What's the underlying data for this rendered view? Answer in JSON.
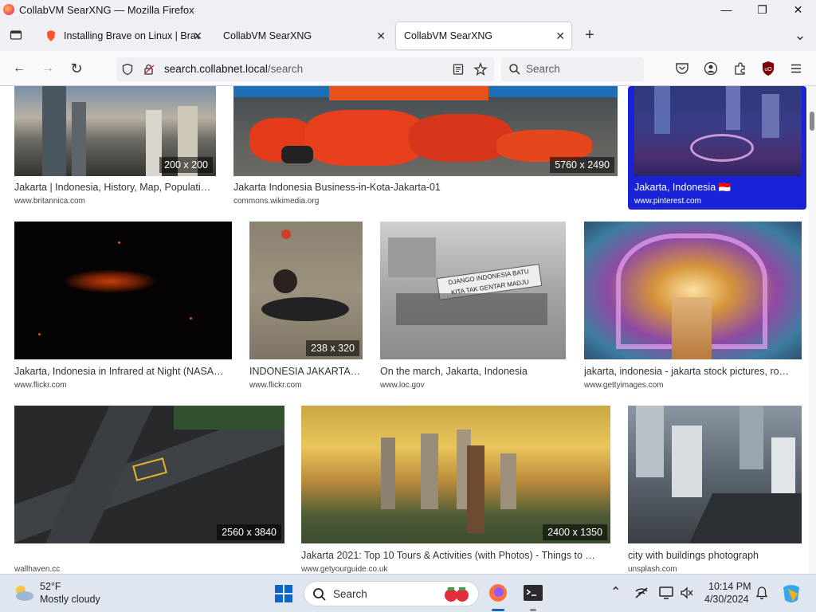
{
  "window": {
    "title": "CollabVM SearXNG — Mozilla Firefox",
    "minimize": "—",
    "maximize": "❐",
    "close": "✕"
  },
  "tabs": [
    {
      "label": "Installing Brave on Linux | Brave",
      "close": "✕"
    },
    {
      "label": "CollabVM SearXNG",
      "close": "✕"
    },
    {
      "label": "CollabVM SearXNG",
      "close": "✕"
    }
  ],
  "new_tab": "+",
  "tab_list": "⌄",
  "nav": {
    "back": "←",
    "forward": "→",
    "reload": "↻",
    "url_host": "search.collabnet.local",
    "url_path": "/search",
    "search_placeholder": "Search"
  },
  "results": [
    {
      "title": "Jakarta | Indonesia, History, Map, Populati…",
      "source": "www.britannica.com",
      "dims": "200 x 200"
    },
    {
      "title": "Jakarta Indonesia Business-in-Kota-Jakarta-01",
      "source": "commons.wikimedia.org",
      "dims": "5760 x 2490"
    },
    {
      "title": "Jakarta, Indonesia 🇮🇩",
      "source": "www.pinterest.com",
      "dims": ""
    },
    {
      "title": "Jakarta, Indonesia in Infrared at Night (NASA…",
      "source": "www.flickr.com",
      "dims": ""
    },
    {
      "title": "INDONESIA JAKARTA…",
      "source": "www.flickr.com",
      "dims": "238 x 320"
    },
    {
      "title": "On the march, Jakarta, Indonesia",
      "source": "www.loc.gov",
      "dims": ""
    },
    {
      "title": "jakarta, indonesia - jakarta stock pictures, ro…",
      "source": "www.gettyimages.com",
      "dims": ""
    },
    {
      "title": "",
      "source": "wallhaven.cc",
      "dims": "2560 x 3840"
    },
    {
      "title": "Jakarta 2021: Top 10 Tours & Activities (with Photos) - Things to …",
      "source": "www.getyourguide.co.uk",
      "dims": "2400 x 1350"
    },
    {
      "title": "city with buildings photograph",
      "source": "unsplash.com",
      "dims": ""
    }
  ],
  "image_banner": {
    "line1": "DJANGO INDONESIA BATU",
    "line2": "KITA TAK GENTAR MADJU"
  },
  "taskbar": {
    "temp": "52°F",
    "condition": "Mostly cloudy",
    "search": "Search",
    "time": "10:14 PM",
    "date": "4/30/2024",
    "overflow": "⌃",
    "notifications": "🔔"
  }
}
